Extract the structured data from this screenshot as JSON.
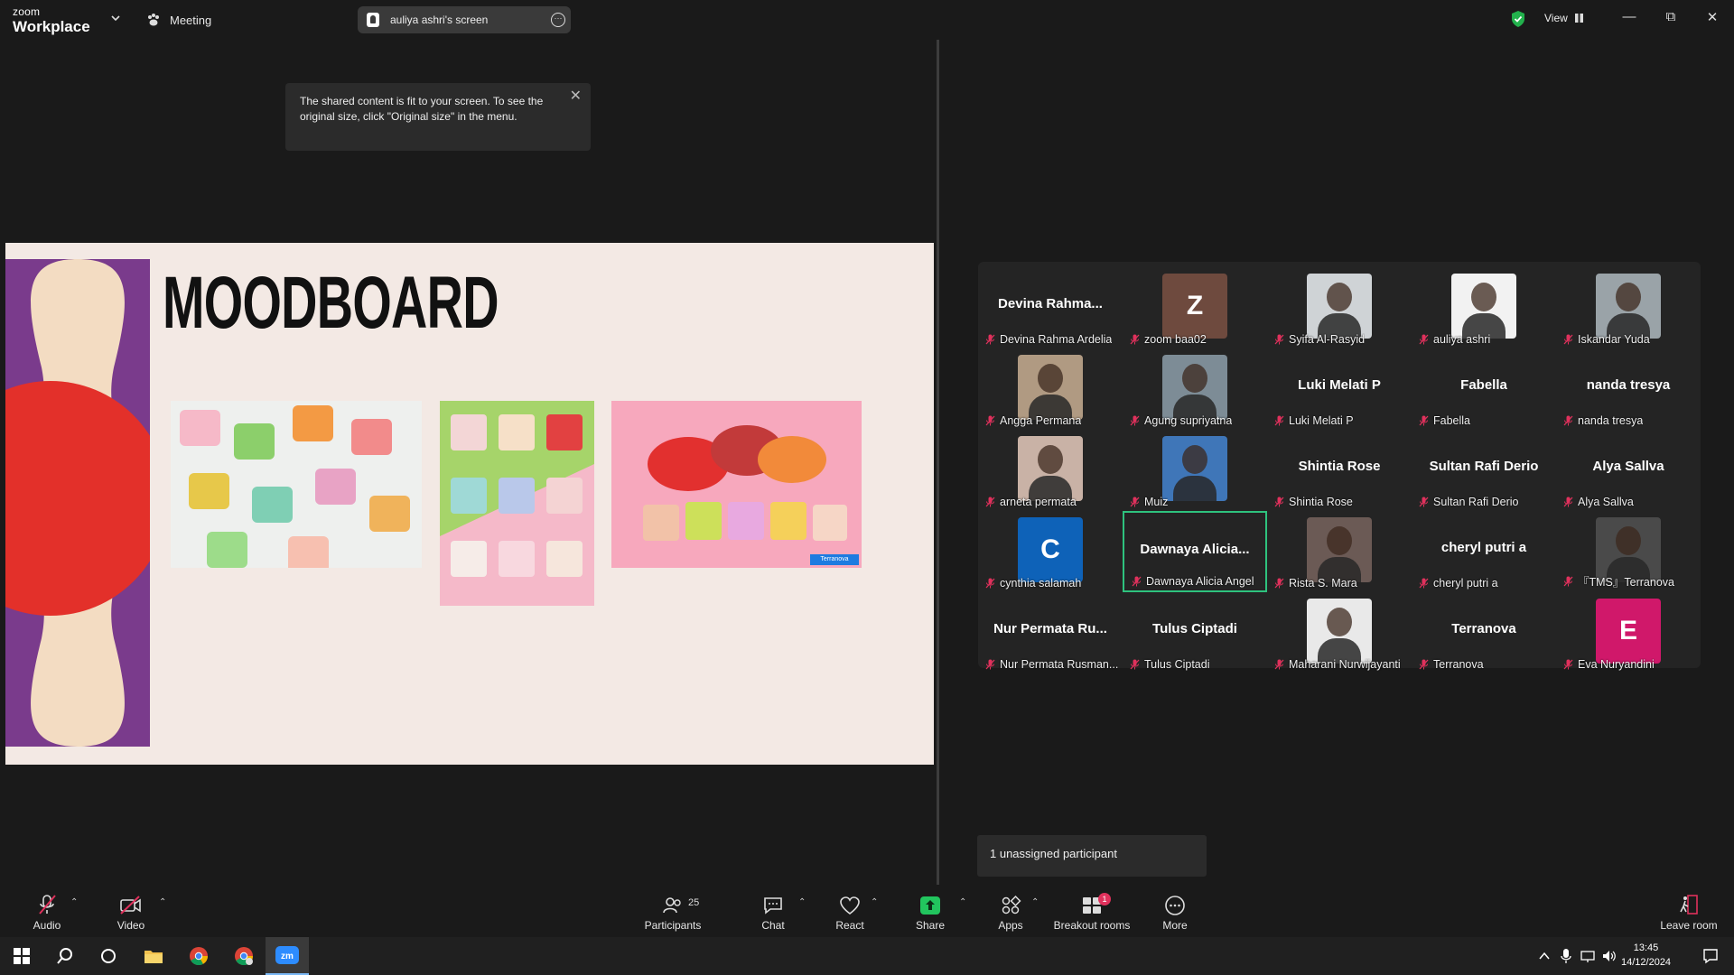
{
  "titlebar": {
    "logo_top": "zoom",
    "logo_bottom": "Workplace",
    "meeting_label": "Meeting",
    "screen_label": "auliya ashri's screen",
    "view_label": "View"
  },
  "tooltip": {
    "text": "The shared content is fit to your screen. To see the original size, click \"Original size\" in the menu."
  },
  "slide": {
    "title": "MOODBOARD",
    "tag": "Terranova"
  },
  "participants": [
    {
      "label": "Devina Rahma Ardelia",
      "display": "Devina Rahma...",
      "type": "name"
    },
    {
      "label": "zoom baa02",
      "display": "Z",
      "type": "letter",
      "color": "#6e4a3e"
    },
    {
      "label": "Syifa Al-Rasyid",
      "type": "photo",
      "color": "#cfd3d6"
    },
    {
      "label": "auliya ashri",
      "type": "photo",
      "color": "#f2f2f2"
    },
    {
      "label": "Iskandar Yuda",
      "type": "photo",
      "color": "#9aa3a8"
    },
    {
      "label": "Angga Permana",
      "type": "photo",
      "color": "#b09a82"
    },
    {
      "label": "Agung supriyatna",
      "type": "photo",
      "color": "#7d8c96"
    },
    {
      "label": "Luki Melati P",
      "display": "Luki Melati P",
      "type": "name"
    },
    {
      "label": "Fabella",
      "display": "Fabella",
      "type": "name"
    },
    {
      "label": "nanda tresya",
      "display": "nanda tresya",
      "type": "name"
    },
    {
      "label": "arneta permata",
      "type": "photo",
      "color": "#c9b2a6"
    },
    {
      "label": "Muiz",
      "type": "photo",
      "color": "#3f76b8"
    },
    {
      "label": "Shintia Rose",
      "display": "Shintia Rose",
      "type": "name"
    },
    {
      "label": "Sultan Rafi Derio",
      "display": "Sultan Rafi Derio",
      "type": "name"
    },
    {
      "label": "Alya Sallva",
      "display": "Alya Sallva",
      "type": "name"
    },
    {
      "label": "cynthia salamah",
      "display": "C",
      "type": "letter",
      "color": "#0e62b8"
    },
    {
      "label": "Dawnaya Alicia Angel",
      "display": "Dawnaya Alicia...",
      "type": "name",
      "active": true
    },
    {
      "label": "Rista S. Mara",
      "type": "photo",
      "color": "#6b5a55"
    },
    {
      "label": "cheryl putri a",
      "display": "cheryl putri a",
      "type": "name"
    },
    {
      "label": "『TMS』Terranova",
      "type": "photo",
      "color": "#4a4a4a"
    },
    {
      "label": "Nur Permata Rusman...",
      "display": "Nur Permata Ru...",
      "type": "name"
    },
    {
      "label": "Tulus Ciptadi",
      "display": "Tulus Ciptadi",
      "type": "name"
    },
    {
      "label": "Maharani Nurwijayanti",
      "type": "photo",
      "color": "#e9e9e9"
    },
    {
      "label": "Terranova",
      "display": "Terranova",
      "type": "name"
    },
    {
      "label": "Eva Nuryandini",
      "display": "E",
      "type": "letter",
      "color": "#d0186a"
    }
  ],
  "unassigned": "1 unassigned participant",
  "toolbar": {
    "audio": "Audio",
    "video": "Video",
    "participants": "Participants",
    "participants_count": "25",
    "chat": "Chat",
    "react": "React",
    "share": "Share",
    "apps": "Apps",
    "breakout": "Breakout rooms",
    "breakout_badge": "1",
    "more": "More",
    "leave": "Leave room"
  },
  "taskbar": {
    "time": "13:45",
    "date": "14/12/2024"
  }
}
